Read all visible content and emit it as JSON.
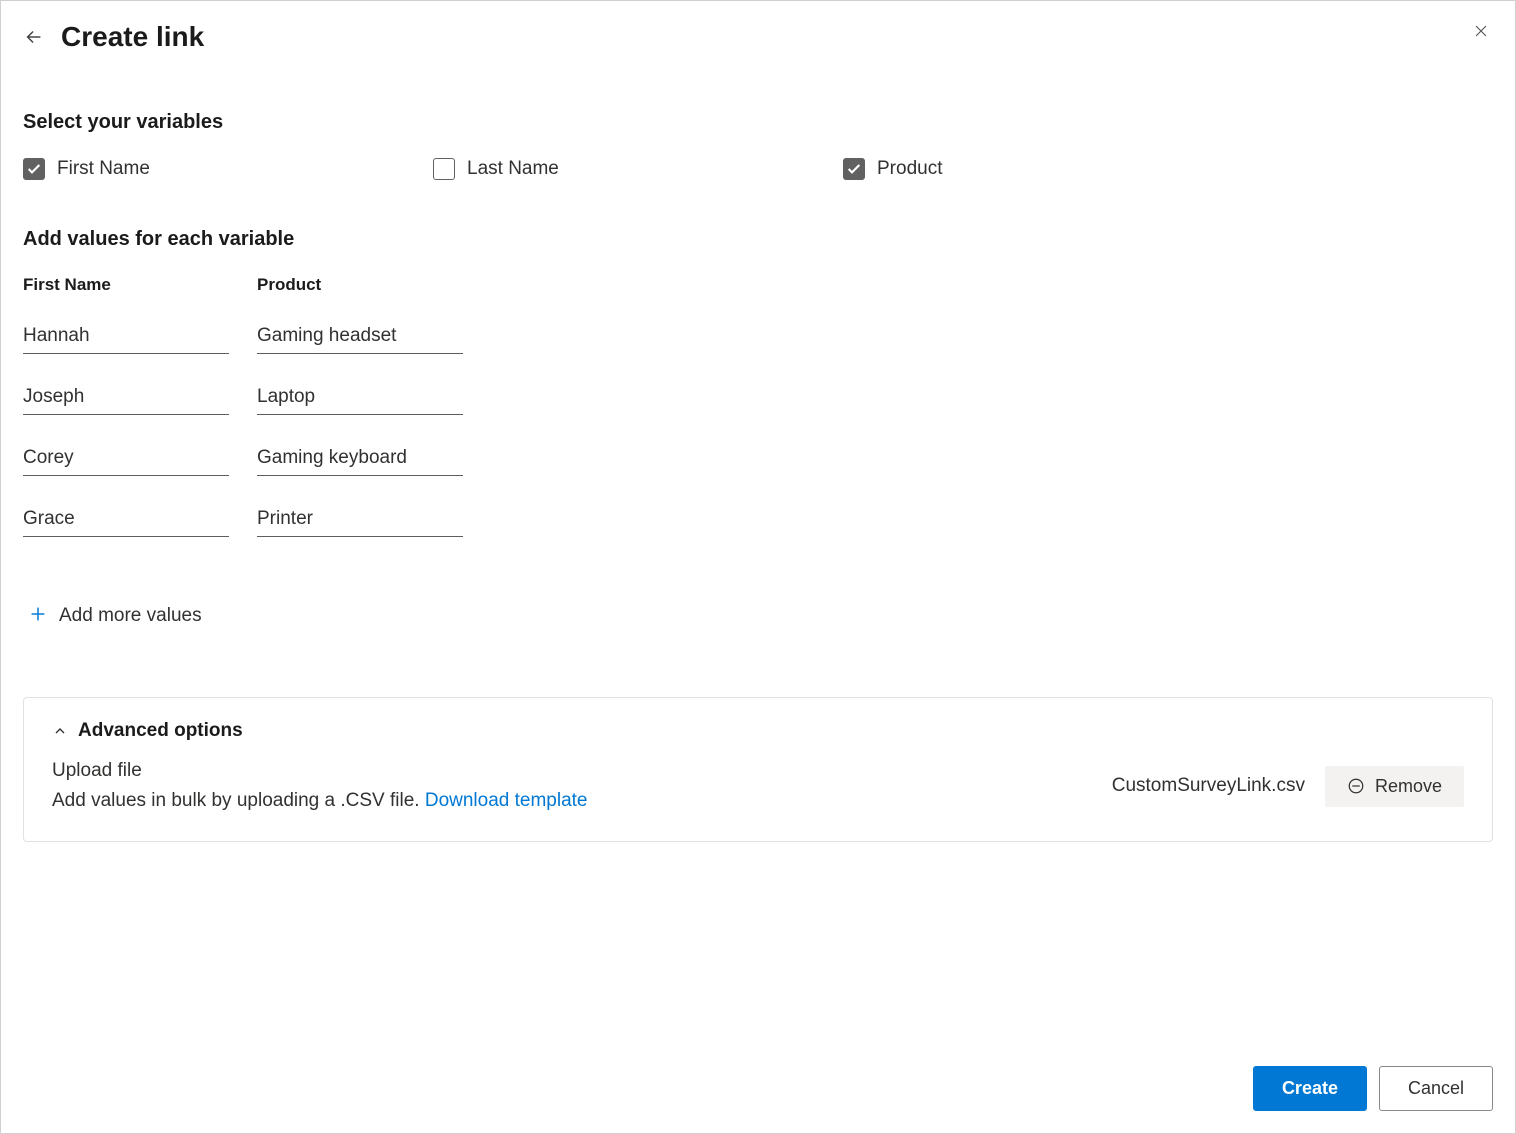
{
  "header": {
    "title": "Create link"
  },
  "sections": {
    "select_variables_heading": "Select your variables",
    "add_values_heading": "Add values for each variable"
  },
  "variables": [
    {
      "label": "First Name",
      "checked": true
    },
    {
      "label": "Last Name",
      "checked": false
    },
    {
      "label": "Product",
      "checked": true
    }
  ],
  "columns": {
    "first_name": "First Name",
    "product": "Product"
  },
  "rows": [
    {
      "first_name": "Hannah",
      "product": "Gaming headset"
    },
    {
      "first_name": "Joseph",
      "product": "Laptop"
    },
    {
      "first_name": "Corey",
      "product": "Gaming keyboard"
    },
    {
      "first_name": "Grace",
      "product": "Printer"
    }
  ],
  "add_more_label": "Add more values",
  "advanced": {
    "title": "Advanced options",
    "upload_label": "Upload file",
    "upload_desc": "Add values in bulk by uploading a .CSV file. ",
    "download_link": "Download template",
    "file_name": "CustomSurveyLink.csv",
    "remove_label": "Remove"
  },
  "footer": {
    "create": "Create",
    "cancel": "Cancel"
  }
}
